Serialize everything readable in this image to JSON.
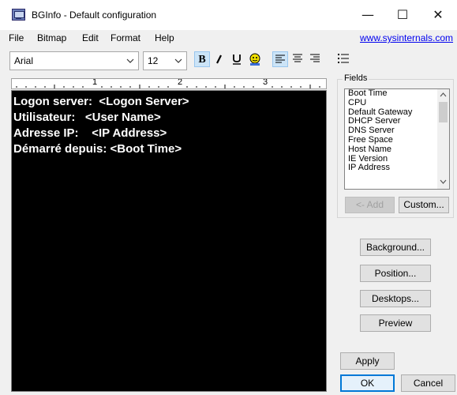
{
  "window": {
    "title": "BGInfo - Default configuration",
    "controls": {
      "minimize": "—",
      "maximize": "☐",
      "close": "✕"
    }
  },
  "menu": {
    "items": [
      "File",
      "Bitmap",
      "Edit",
      "Format",
      "Help"
    ],
    "link": "www.sysinternals.com"
  },
  "toolbar": {
    "font": "Arial",
    "size": "12",
    "bold": "B",
    "italic": "𝘐",
    "underline": "U",
    "insert_image_icon": "picture-icon",
    "align_left_icon": "align-left-icon",
    "align_center_icon": "align-center-icon",
    "align_right_icon": "align-right-icon",
    "bullets_icon": "bullet-list-icon"
  },
  "ruler": {
    "numbers": [
      "1",
      "2",
      "3"
    ]
  },
  "editor": {
    "lines": [
      "Logon server:  <Logon Server>",
      "Utilisateur:   <User Name>",
      "Adresse IP:    <IP Address>",
      "Démarré depuis: <Boot Time>"
    ]
  },
  "fields": {
    "label": "Fields",
    "items": [
      "Boot Time",
      "CPU",
      "Default Gateway",
      "DHCP Server",
      "DNS Server",
      "Free Space",
      "Host Name",
      "IE Version",
      "IP Address"
    ],
    "add_button": "<- Add",
    "custom_button": "Custom..."
  },
  "buttons": {
    "background": "Background...",
    "position": "Position...",
    "desktops": "Desktops...",
    "preview": "Preview",
    "apply": "Apply",
    "ok": "OK",
    "cancel": "Cancel"
  },
  "colors": {
    "editor_bg": "#000000",
    "editor_text": "#ffffff",
    "link": "#0000ee",
    "accent": "#0078d7"
  }
}
